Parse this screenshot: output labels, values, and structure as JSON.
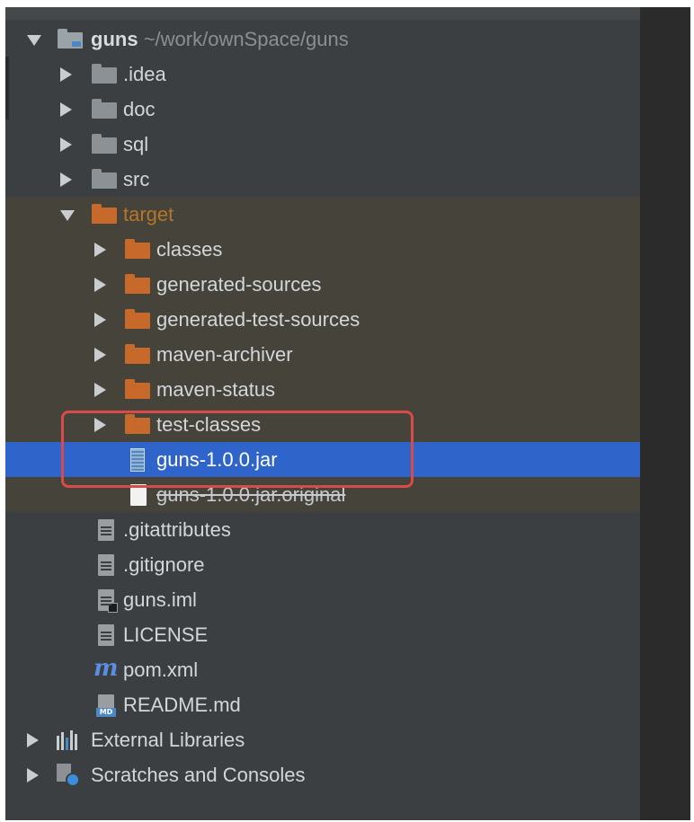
{
  "project": {
    "name": "guns",
    "path": "~/work/ownSpace/guns"
  },
  "tree": {
    "idea": ".idea",
    "doc": "doc",
    "sql": "sql",
    "src": "src",
    "target": "target",
    "target_children": {
      "classes": "classes",
      "generated_sources": "generated-sources",
      "generated_test_sources": "generated-test-sources",
      "maven_archiver": "maven-archiver",
      "maven_status": "maven-status",
      "test_classes": "test-classes",
      "jar": "guns-1.0.0.jar",
      "jar_original": "guns-1.0.0.jar.original"
    },
    "files": {
      "gitattributes": ".gitattributes",
      "gitignore": ".gitignore",
      "iml": "guns.iml",
      "license": "LICENSE",
      "pom": "pom.xml",
      "readme": "README.md"
    },
    "external_libraries": "External Libraries",
    "scratches": "Scratches and Consoles"
  },
  "icons": {
    "maven_glyph": "m",
    "md_badge": "MD"
  },
  "colors": {
    "panel_bg": "#3c3f41",
    "selection": "#2f65ca",
    "excluded_bg": "#45433a",
    "excluded_folder": "#c8692c",
    "highlight_box": "#d94a4a"
  }
}
